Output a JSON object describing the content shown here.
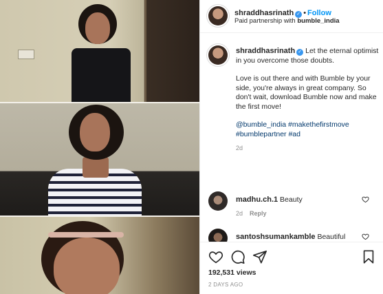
{
  "post": {
    "username": "shraddhasrinath",
    "follow_label": "Follow",
    "separator": "•",
    "partnership": "Paid partnership with",
    "partner_handle": "bumble_india",
    "caption": {
      "line1": "Let the eternal optimist in you overcome those doubts.",
      "para2": "Love is out there and with Bumble by your side, you're always in great company. So don't wait, download Bumble now and make the first move!",
      "tags": [
        "@bumble_india",
        "#makethefirstmove",
        "#bumblepartner",
        "#ad"
      ],
      "time": "2d"
    },
    "comments": [
      {
        "username": "madhu.ch.1",
        "text": "Beauty",
        "time": "2d",
        "reply_label": "Reply"
      },
      {
        "username": "santoshsumankamble",
        "text": "Beautiful"
      }
    ],
    "views": "192,531 views",
    "posted_ago": "2 DAYS AGO"
  },
  "icons": {
    "verified": "verified-badge-icon",
    "more": "more-options-icon",
    "like": "heart-icon",
    "comment": "comment-bubble-icon",
    "share": "paper-plane-icon",
    "save": "bookmark-icon"
  },
  "colors": {
    "link": "#0095f6",
    "hashtag": "#00376b",
    "verified": "#3897f0",
    "muted": "#8e8e8e"
  }
}
